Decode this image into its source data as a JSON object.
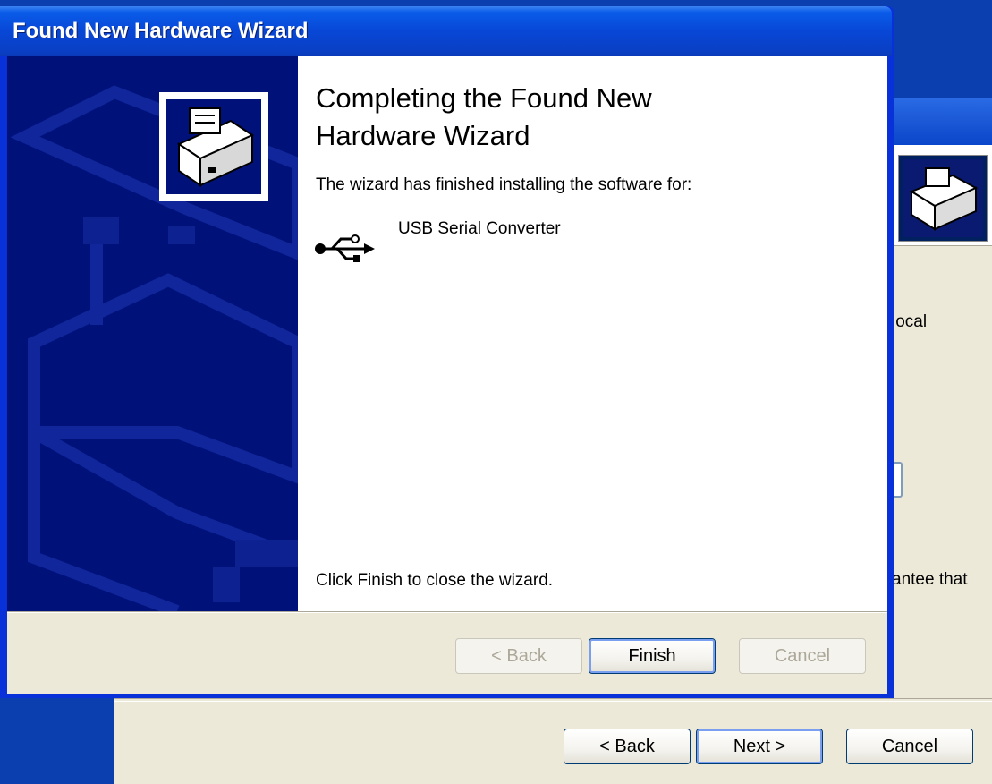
{
  "background_wizard": {
    "partial_text_1": "local",
    "partial_text_2": "antee that",
    "buttons": {
      "back": "< Back",
      "next": "Next >",
      "cancel": "Cancel"
    }
  },
  "wizard": {
    "title": "Found New Hardware Wizard",
    "heading_line1": "Completing the Found New",
    "heading_line2": "Hardware Wizard",
    "finished_message": "The wizard has finished installing the software for:",
    "device_icon": "usb-icon",
    "device_name": "USB Serial Converter",
    "close_message": "Click Finish to close the wizard.",
    "buttons": {
      "back": "< Back",
      "finish": "Finish",
      "cancel": "Cancel"
    },
    "button_states": {
      "back_enabled": false,
      "finish_enabled": true,
      "cancel_enabled": false
    }
  },
  "colors": {
    "title_bar": "#0a5ce9",
    "side_panel": "#00127a",
    "dialog_face": "#ece9d8"
  }
}
